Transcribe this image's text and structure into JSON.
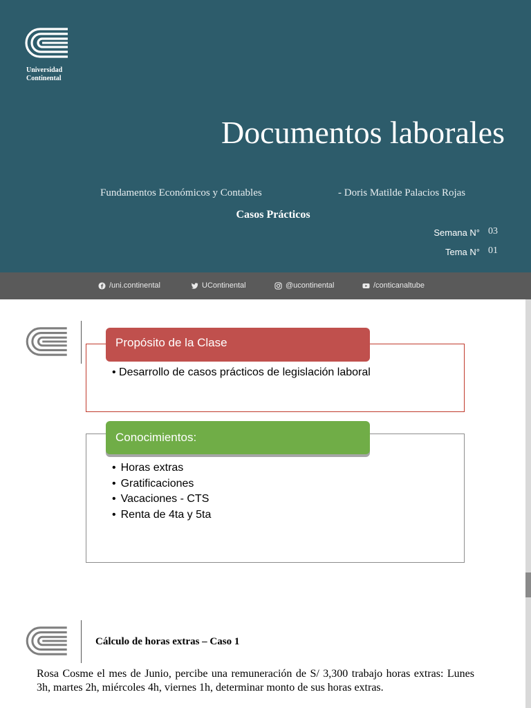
{
  "slide1": {
    "university": [
      "Universidad",
      "Continental"
    ],
    "title": "Documentos laborales",
    "course": "Fundamentos Económicos y Contables",
    "author": "- Doris Matilde Palacios Rojas",
    "subtitle": "Casos Prácticos",
    "semana_label": "Semana N°",
    "semana_value": "03",
    "tema_label": "Tema N°",
    "tema_value": "01",
    "colors": {
      "background": "#2d5c6b",
      "social_bar": "#5a5a5a"
    }
  },
  "social": [
    {
      "icon": "facebook-icon",
      "label": "/uni.continental"
    },
    {
      "icon": "twitter-icon",
      "label": "UContinental"
    },
    {
      "icon": "instagram-icon",
      "label": "@ucontinental"
    },
    {
      "icon": "youtube-icon",
      "label": "/conticanaltube"
    }
  ],
  "slide2": {
    "purpose_header": "Propósito de la Clase",
    "purpose_item": "Desarrollo de casos prácticos de legislación laboral",
    "knowledge_header": "Conocimientos:",
    "knowledge_items": [
      "Horas extras",
      "Gratificaciones",
      "Vacaciones - CTS",
      "Renta de 4ta y 5ta"
    ],
    "colors": {
      "purpose": "#c0504d",
      "knowledge": "#70ad47"
    }
  },
  "slide3": {
    "title": "Cálculo de horas extras – Caso 1",
    "text": "Rosa Cosme el mes de Junio, percibe una remuneración de S/ 3,300 trabajo horas extras: Lunes 3h, martes 2h, miércoles 4h, viernes 1h, determinar monto de sus horas extras."
  }
}
